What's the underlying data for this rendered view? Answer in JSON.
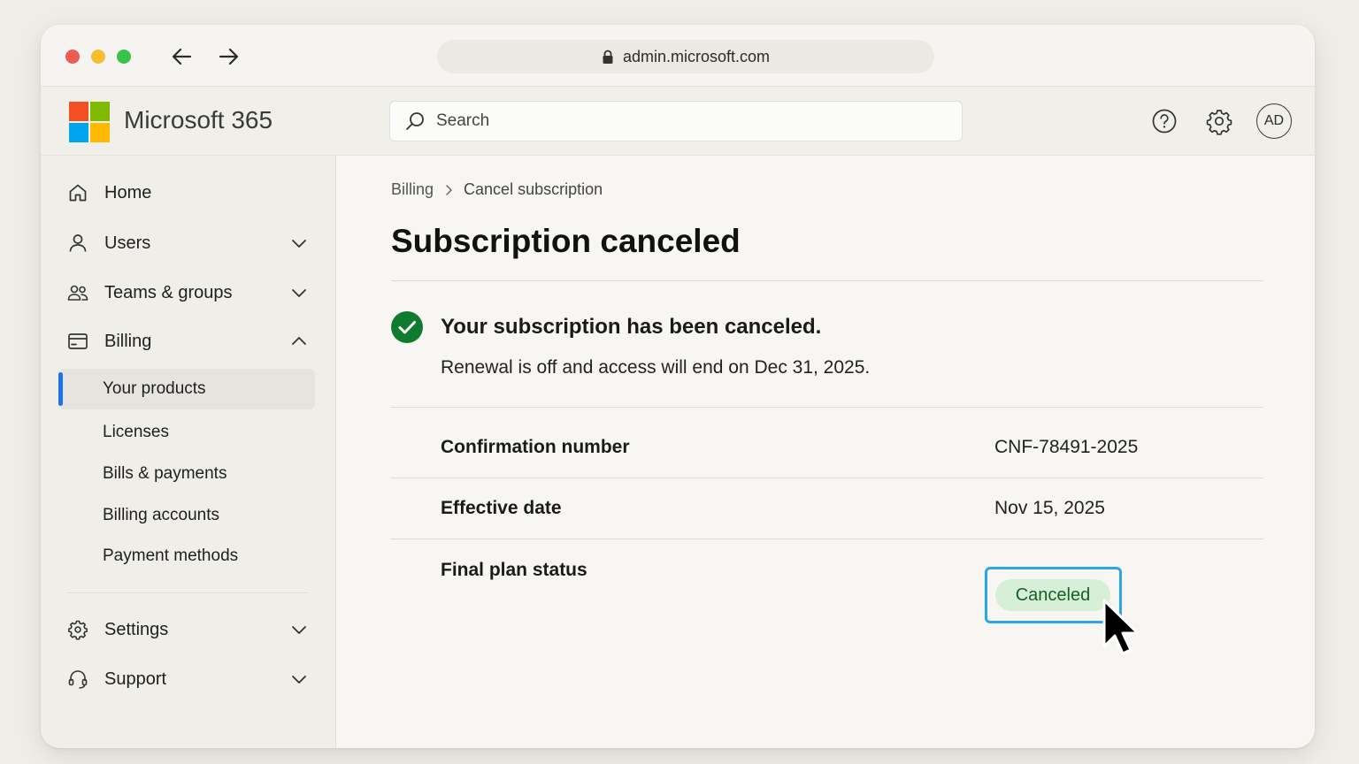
{
  "browser": {
    "url": "admin.microsoft.com"
  },
  "app": {
    "name": "Microsoft 365",
    "search_placeholder": "Search",
    "avatar_initials": "AD",
    "logo_colors": [
      "#f25022",
      "#7fba00",
      "#00a4ef",
      "#ffb900"
    ]
  },
  "sidebar": {
    "items": [
      {
        "label": "Home",
        "icon": "home-icon"
      },
      {
        "label": "Users",
        "icon": "user-icon"
      },
      {
        "label": "Teams & groups",
        "icon": "people-icon"
      },
      {
        "label": "Billing",
        "icon": "billing-icon"
      },
      {
        "label": "Settings",
        "icon": "gear-icon"
      },
      {
        "label": "Support",
        "icon": "headset-icon"
      }
    ],
    "billing_sub": [
      "Your products",
      "Licenses",
      "Bills & payments",
      "Billing accounts",
      "Payment methods"
    ],
    "active_sub": "Your products",
    "accent_color": "#1a73e8"
  },
  "main": {
    "breadcrumb": [
      "Billing",
      "Cancel subscription"
    ],
    "title": "Subscription canceled",
    "message_heading": "Your subscription has been canceled.",
    "message_detail": "Renewal is off and access will end on Dec 31, 2025.",
    "details": [
      {
        "label": "Confirmation number",
        "value": "CNF-78491-2025"
      },
      {
        "label": "Effective date",
        "value": "Nov 15, 2025"
      },
      {
        "label": "Final plan status",
        "value": "Canceled"
      }
    ],
    "success_color": "#0f7b2e",
    "status_pill_color": "#d7efd6"
  }
}
